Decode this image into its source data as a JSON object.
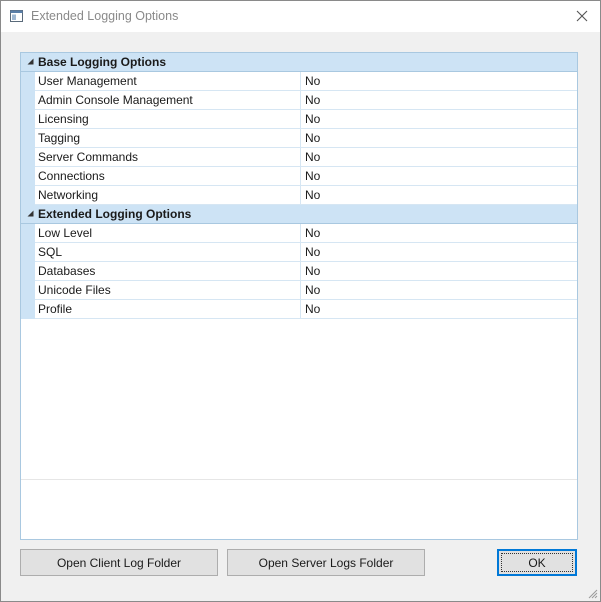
{
  "window": {
    "title": "Extended Logging Options"
  },
  "icons": {
    "app": "app-window-icon",
    "close": "close-icon",
    "expanded": "triangle-expanded-icon",
    "resize": "resize-grip-icon"
  },
  "colors": {
    "section_bg": "#cde3f5",
    "grid_border": "#a9c8e0",
    "default_button_border": "#0078d7"
  },
  "sections": [
    {
      "label": "Base Logging Options",
      "rows": [
        {
          "name": "User Management",
          "value": "No"
        },
        {
          "name": "Admin Console Management",
          "value": "No"
        },
        {
          "name": "Licensing",
          "value": "No"
        },
        {
          "name": "Tagging",
          "value": "No"
        },
        {
          "name": "Server Commands",
          "value": "No"
        },
        {
          "name": "Connections",
          "value": "No"
        },
        {
          "name": "Networking",
          "value": "No"
        }
      ]
    },
    {
      "label": "Extended Logging Options",
      "rows": [
        {
          "name": "Low Level",
          "value": "No"
        },
        {
          "name": "SQL",
          "value": "No"
        },
        {
          "name": "Databases",
          "value": "No"
        },
        {
          "name": "Unicode Files",
          "value": "No"
        },
        {
          "name": "Profile",
          "value": "No"
        }
      ]
    }
  ],
  "buttons": {
    "open_client_log": "Open Client Log Folder",
    "open_server_logs": "Open Server Logs Folder",
    "ok": "OK"
  }
}
